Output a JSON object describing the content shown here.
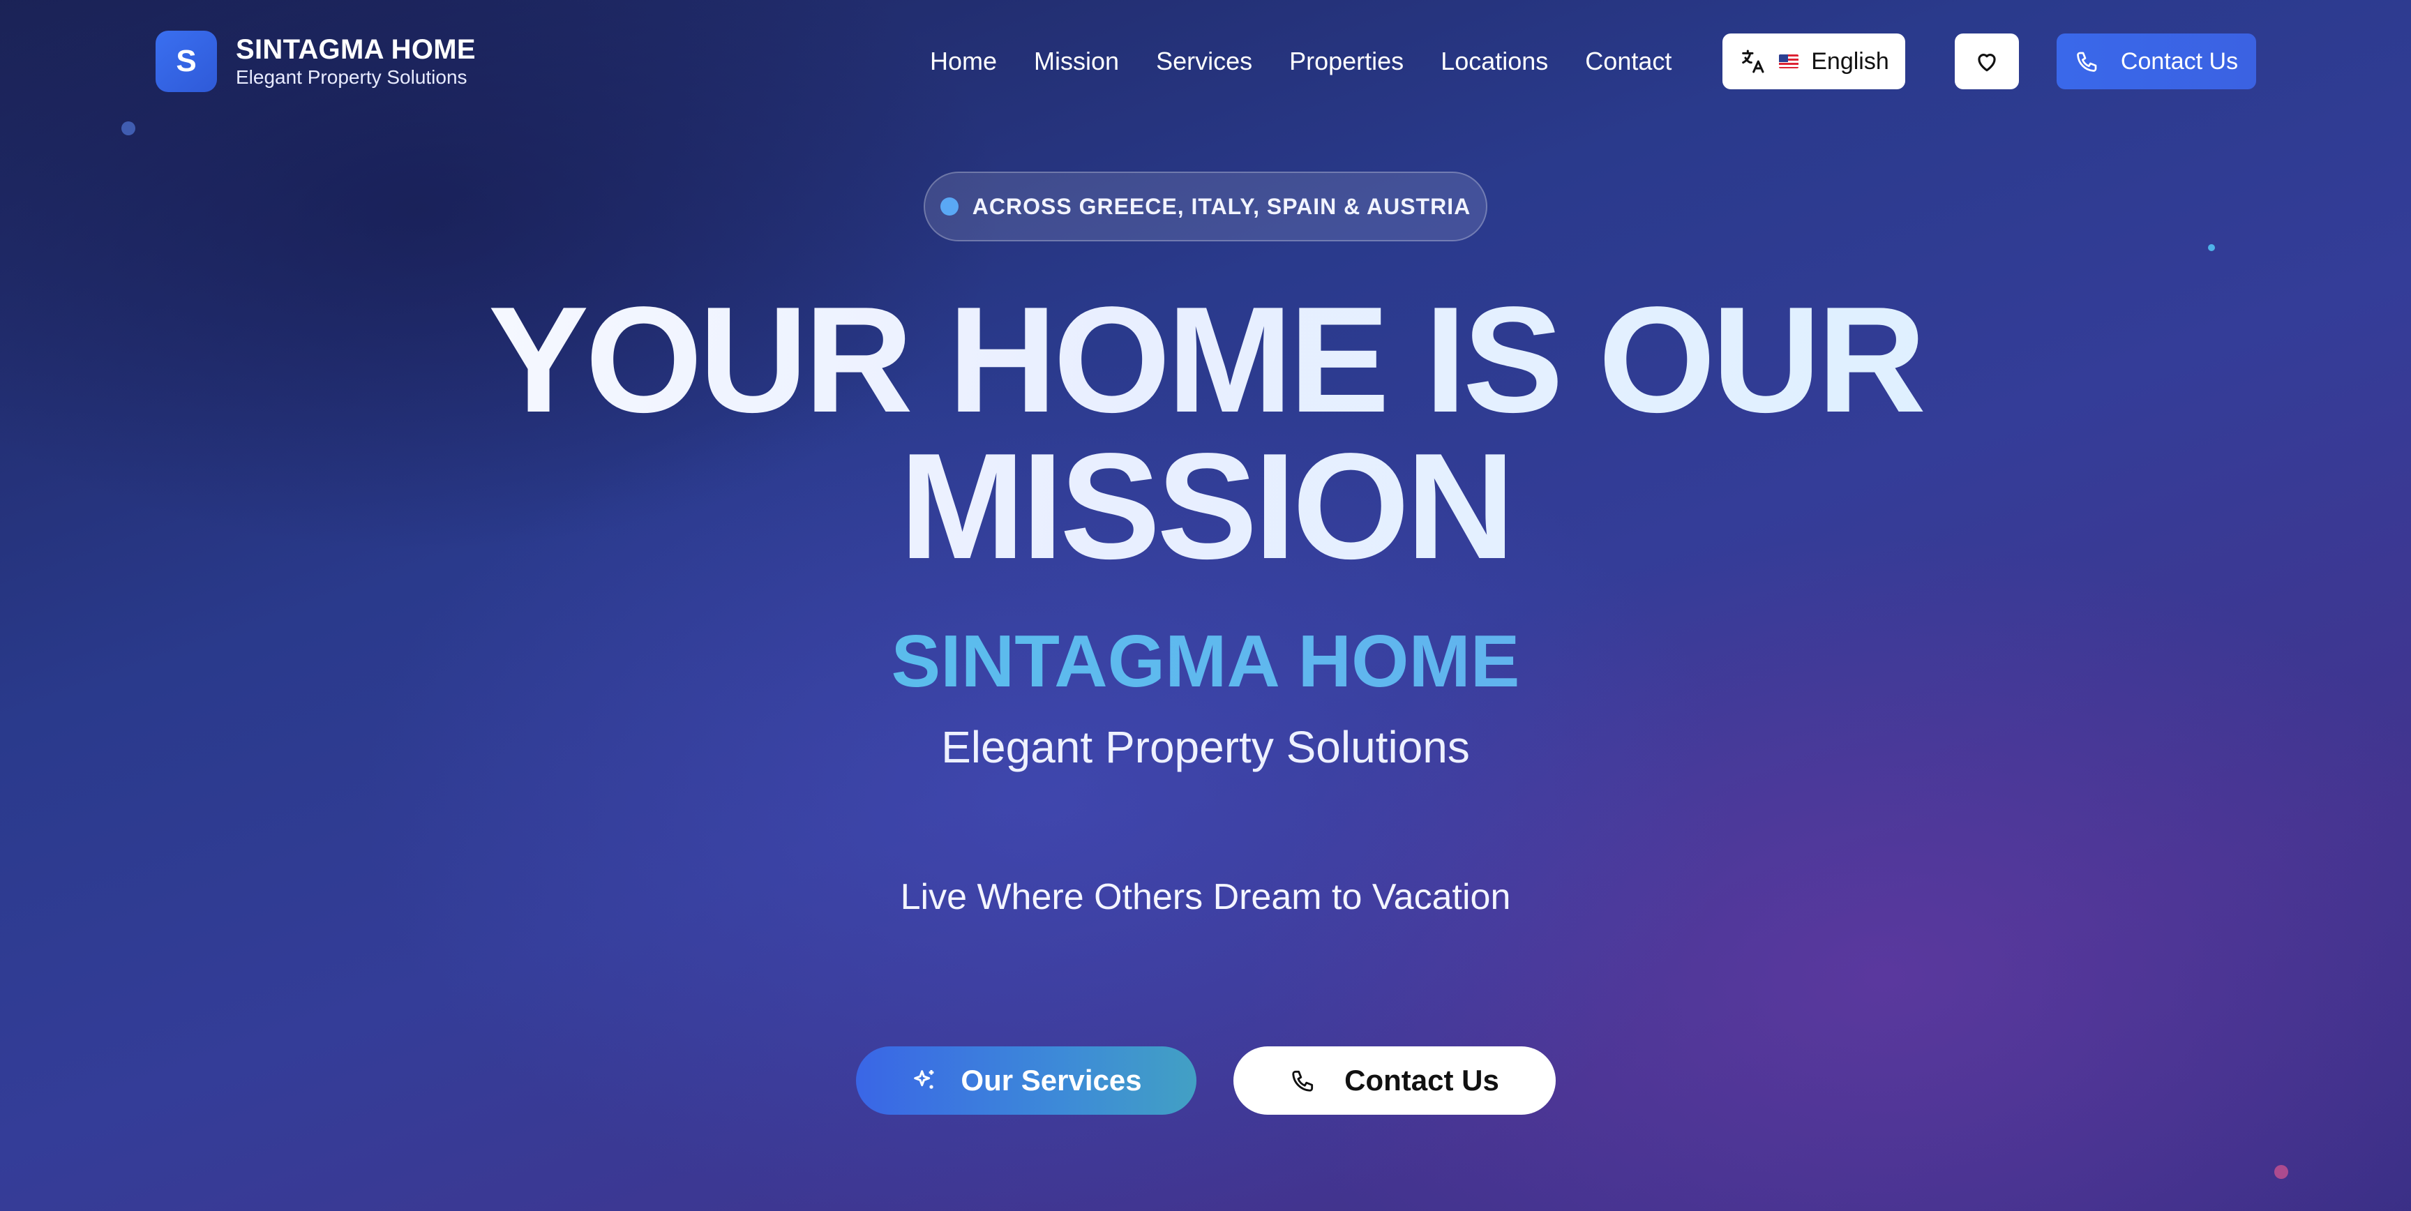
{
  "header": {
    "logo_letter": "S",
    "logo_title": "SINTAGMA HOME",
    "logo_subtitle": "Elegant Property Solutions",
    "nav": [
      "Home",
      "Mission",
      "Services",
      "Properties",
      "Locations",
      "Contact"
    ],
    "language_label": "English",
    "language_icon": "translate-icon",
    "flag_icon": "us-flag-icon",
    "favorites_icon": "heart-icon",
    "contact_label": "Contact Us",
    "contact_icon": "phone-icon"
  },
  "hero": {
    "badge": "ACROSS GREECE, ITALY, SPAIN & AUSTRIA",
    "headline_line1": "YOUR HOME IS OUR",
    "headline_line2": "MISSION",
    "brand": "SINTAGMA HOME",
    "tagline": "Elegant Property Solutions",
    "slogan": "Live Where Others Dream to Vacation",
    "primary_button": "Our Services",
    "primary_icon": "sparkles-icon",
    "secondary_button": "Contact Us",
    "secondary_icon": "phone-icon"
  },
  "colors": {
    "accent": "#3b66e6",
    "brand_gradient_start": "#4fc6e8",
    "brand_gradient_end": "#67a4ef",
    "badge_dot": "#5aa8f5"
  }
}
